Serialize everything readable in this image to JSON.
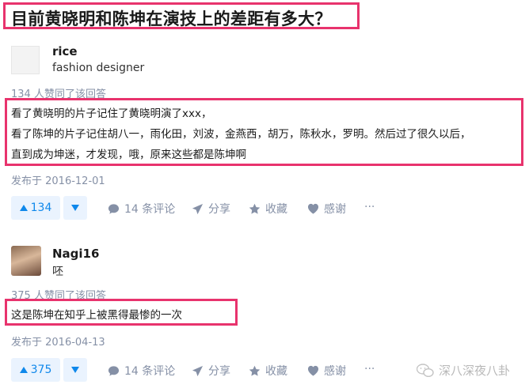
{
  "question": {
    "title": "目前黄晓明和陈坤在演技上的差距有多大？"
  },
  "answers": [
    {
      "author_name": "rice",
      "author_bio": "fashion designer",
      "likes_text": "134 人赞同了该回答",
      "content_lines": [
        "看了黄晓明的片子记住了黄晓明演了xxx，",
        "看了陈坤的片子记住胡八一，雨化田，刘波，金燕西，胡万，陈秋水，罗明。然后过了很久以后，",
        "直到成为坤迷，才发现，哦，原来这些都是陈坤啊"
      ],
      "published": "发布于 2016-12-01",
      "upvote_count": "134",
      "comments": "14 条评论",
      "share": "分享",
      "collect": "收藏",
      "thanks": "感谢",
      "more": "···"
    },
    {
      "author_name": "Nagi16",
      "author_bio": "呸",
      "likes_text": "375 人赞同了该回答",
      "content_lines": [
        "这是陈坤在知乎上被黑得最惨的一次"
      ],
      "published": "发布于 2016-04-13",
      "upvote_count": "375",
      "comments": "14 条评论",
      "share": "分享",
      "collect": "收藏",
      "thanks": "感谢",
      "more": "···"
    }
  ],
  "watermark": {
    "text": "深八深夜八卦"
  },
  "colors": {
    "highlight": "#e8336d",
    "accent": "#0f88eb",
    "muted": "#8590a6"
  },
  "icons": [
    "upvote-icon",
    "downvote-icon",
    "comment-icon",
    "share-icon",
    "star-icon",
    "heart-icon",
    "more-icon",
    "wechat-icon"
  ]
}
